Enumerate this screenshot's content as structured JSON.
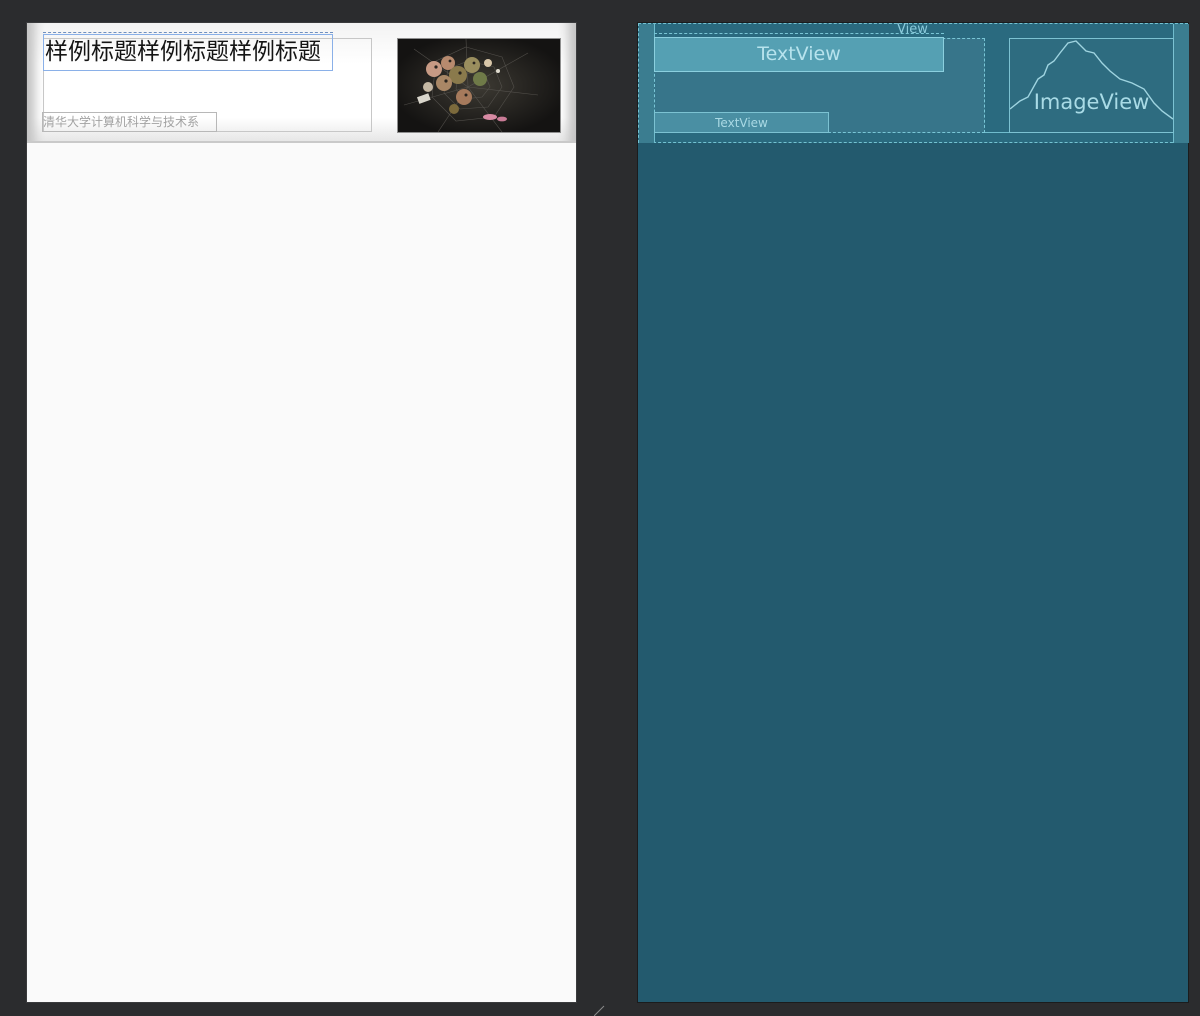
{
  "design": {
    "title": "样例标题样例标题样例标题",
    "subtitle": "清华大学计算机科学与技术系"
  },
  "blueprint": {
    "view_label": "View",
    "title_label": "TextView",
    "subtitle_label": "TextView",
    "image_label": "ImageView"
  },
  "colors": {
    "editor_background": "#2b2c2e",
    "design_surface": "#fafafa",
    "blueprint_surface": "#235a6e",
    "blueprint_outline": "#74c3d3",
    "selection_outline": "#8ab0e8"
  },
  "icons": {
    "image_placeholder": "mountain-icon",
    "resize_grip": "resize-grip-icon"
  }
}
